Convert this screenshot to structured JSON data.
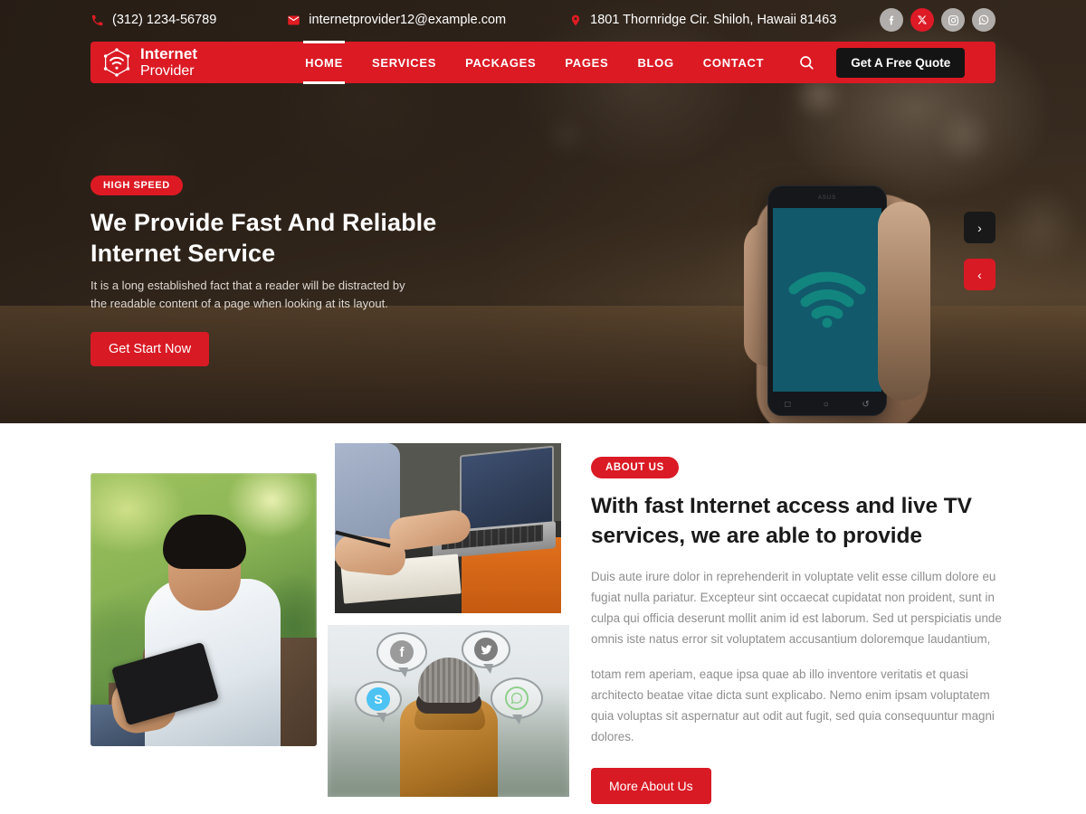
{
  "topbar": {
    "phone": "(312) 1234-56789",
    "email": "internetprovider12@example.com",
    "address": "1801 Thornridge Cir. Shiloh, Hawaii 81463",
    "socials": [
      {
        "name": "facebook",
        "glyph": "f"
      },
      {
        "name": "x-twitter",
        "glyph": "✕"
      },
      {
        "name": "instagram",
        "glyph": "□"
      },
      {
        "name": "whatsapp",
        "glyph": "✆"
      }
    ]
  },
  "nav": {
    "logo_line1": "Internet",
    "logo_line2": "Provider",
    "items": [
      {
        "label": "HOME",
        "active": true
      },
      {
        "label": "SERVICES",
        "active": false
      },
      {
        "label": "PACKAGES",
        "active": false
      },
      {
        "label": "PAGES",
        "active": false
      },
      {
        "label": "BLOG",
        "active": false
      },
      {
        "label": "CONTACT",
        "active": false
      }
    ],
    "search_icon": "search-icon",
    "quote_label": "Get A Free Quote"
  },
  "hero": {
    "badge": "HIGH SPEED",
    "title": "We Provide Fast And Reliable Internet Service",
    "subtitle": "It is a long established fact that a reader will be distracted by the readable content of a page when looking at its layout.",
    "cta_label": "Get Start Now",
    "next_arrow": "›",
    "prev_arrow": "‹"
  },
  "about": {
    "badge": "ABOUT US",
    "title": "With fast Internet access and live TV services, we are able to provide",
    "paragraph1": "Duis aute irure dolor in reprehenderit in voluptate velit esse cillum dolore eu fugiat nulla pariatur. Excepteur sint occaecat cupidatat non proident, sunt in culpa qui  officia deserunt mollit anim id est laborum. Sed ut perspiciatis unde omnis iste natus error sit voluptatem accusantium doloremque laudantium,",
    "paragraph2": "totam rem aperiam, eaque ipsa quae ab illo inventore veritatis et quasi architecto beatae vitae dicta sunt explicabo. Nemo enim ipsam voluptatem quia voluptas sit aspernatur aut odit aut fugit, sed quia consequuntur magni dolores.",
    "cta_label": "More About Us",
    "images": [
      {
        "name": "man-with-tablet-photo",
        "alt": "Smiling man using a tablet outdoors"
      },
      {
        "name": "laptop-workspace-photo",
        "alt": "Person typing on a laptop with a notebook"
      },
      {
        "name": "social-bubbles-photo",
        "alt": "Person from behind with social media chat bubbles"
      }
    ],
    "bubbles": [
      {
        "name": "facebook",
        "glyph": "f",
        "color": "#9b9b9b"
      },
      {
        "name": "twitter",
        "glyph": "❧",
        "color": "#7d7d7d"
      },
      {
        "name": "skype",
        "glyph": "S",
        "color": "#4cc3f2"
      },
      {
        "name": "whatsapp",
        "glyph": "✆",
        "color": "#8ed08b"
      }
    ]
  },
  "colors": {
    "brand_red": "#d81a24",
    "dark": "#141414",
    "hero_overlay": "#372b21",
    "phone_screen": "#11596b"
  }
}
